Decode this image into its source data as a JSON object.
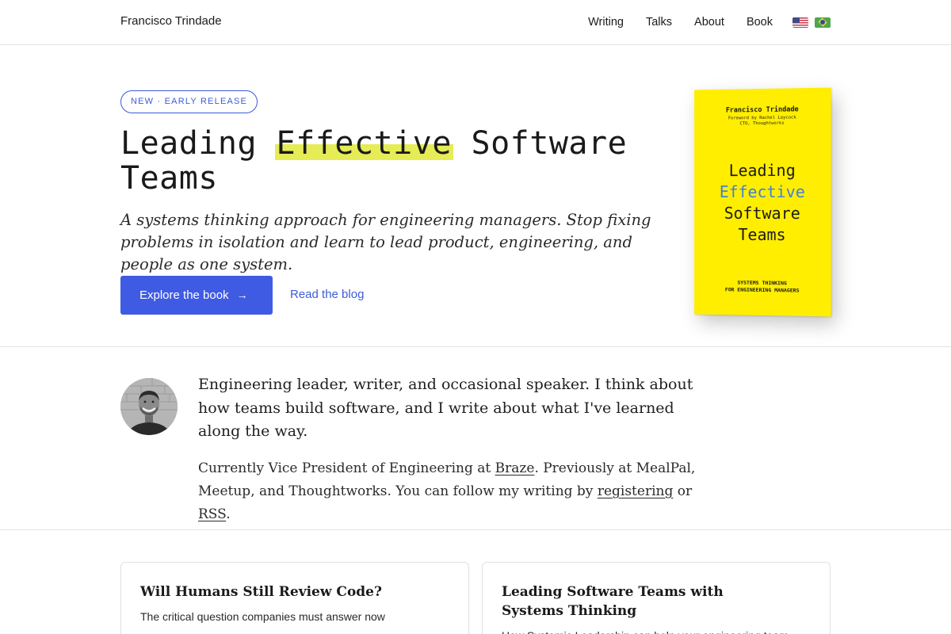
{
  "header": {
    "site_name": "Francisco Trindade",
    "nav": [
      {
        "label": "Writing"
      },
      {
        "label": "Talks"
      },
      {
        "label": "About"
      },
      {
        "label": "Book"
      }
    ],
    "flags": [
      "us-flag-icon",
      "brazil-flag-icon"
    ]
  },
  "hero": {
    "badge": "NEW · EARLY RELEASE",
    "title_before": "Leading ",
    "title_highlight": "Effective",
    "title_after": " Software Teams",
    "subtitle": "A systems thinking approach for engineering managers. Stop fixing problems in isolation and learn to lead product, engineering, and people as one system.",
    "primary_cta": "Explore the book",
    "primary_cta_arrow": "→",
    "secondary_cta": "Read the blog",
    "highlight_color": "#e6ec56",
    "accent_color": "#3f5be3"
  },
  "book_cover": {
    "author": "Francisco Trindade",
    "foreword_line1": "Foreword by Rachel Laycock",
    "foreword_line2": "CTO, Thoughtworks",
    "title_line1": "Leading",
    "title_line2": "Effective",
    "title_line3": "Software",
    "title_line4": "Teams",
    "tagline_line1": "SYSTEMS THINKING",
    "tagline_line2": "FOR ENGINEERING MANAGERS",
    "cover_color": "#ffee00"
  },
  "about": {
    "lead": "Engineering leader, writer, and occasional speaker. I think about how teams build software, and I write about what I've learned along the way.",
    "body_part1": "Currently Vice President of Engineering at ",
    "link_braze": "Braze",
    "body_part2": ". Previously at MealPal, Meetup, and Thoughtworks. You can follow my writing by ",
    "link_register": "registering",
    "body_part3": " or ",
    "link_rss": "RSS",
    "body_part4": "."
  },
  "cards": [
    {
      "title": "Will Humans Still Review Code?",
      "description": "The critical question companies must answer now"
    },
    {
      "title": "Leading Software Teams with Systems Thinking",
      "description": "How Systemic Leadership can help your engineering team"
    }
  ]
}
